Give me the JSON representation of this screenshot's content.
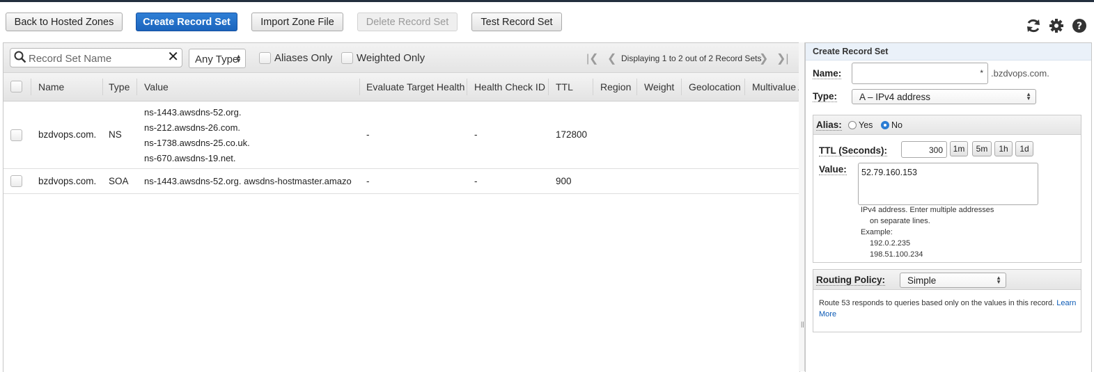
{
  "toolbar": {
    "back": "Back to Hosted Zones",
    "create": "Create Record Set",
    "import": "Import Zone File",
    "delete": "Delete Record Set",
    "test": "Test Record Set"
  },
  "top_icons": [
    "refresh-icon",
    "gear-icon",
    "help-icon"
  ],
  "filter": {
    "search_placeholder": "Record Set Name",
    "type_value": "Any Type",
    "aliases_only": "Aliases Only",
    "weighted_only": "Weighted Only",
    "pagination": "Displaying 1 to 2 out of 2 Record Sets"
  },
  "table": {
    "columns": [
      "Name",
      "Type",
      "Value",
      "Evaluate Target Health",
      "Health Check ID",
      "TTL",
      "Region",
      "Weight",
      "Geolocation",
      "Multivalue A"
    ],
    "rows": [
      {
        "name": "bzdvops.com.",
        "type": "NS",
        "values": [
          "ns-1443.awsdns-52.org.",
          "ns-212.awsdns-26.com.",
          "ns-1738.awsdns-25.co.uk.",
          "ns-670.awsdns-19.net."
        ],
        "eval_health": "-",
        "health_check": "-",
        "ttl": "172800"
      },
      {
        "name": "bzdvops.com.",
        "type": "SOA",
        "values": [
          "ns-1443.awsdns-52.org. awsdns-hostmaster.amazo"
        ],
        "eval_health": "-",
        "health_check": "-",
        "ttl": "900"
      }
    ]
  },
  "panel": {
    "title": "Create Record Set",
    "name_label": "Name:",
    "name_required_mark": "*",
    "name_suffix": ".bzdvops.com.",
    "type_label": "Type:",
    "type_value": "A – IPv4 address",
    "alias_label": "Alias:",
    "alias_yes": "Yes",
    "alias_no": "No",
    "alias_selected": "No",
    "ttl_label": "TTL (Seconds):",
    "ttl_value": "300",
    "ttl_presets": [
      "1m",
      "5m",
      "1h",
      "1d"
    ],
    "value_label": "Value:",
    "value_text": "52.79.160.153",
    "help_lines": [
      "IPv4 address. Enter multiple addresses",
      "on separate lines.",
      "Example:",
      "192.0.2.235",
      "198.51.100.234"
    ],
    "routing_label": "Routing Policy:",
    "routing_value": "Simple",
    "routing_desc": "Route 53 responds to queries based only on the values in this record.",
    "learn": "Learn",
    "more": "More"
  }
}
